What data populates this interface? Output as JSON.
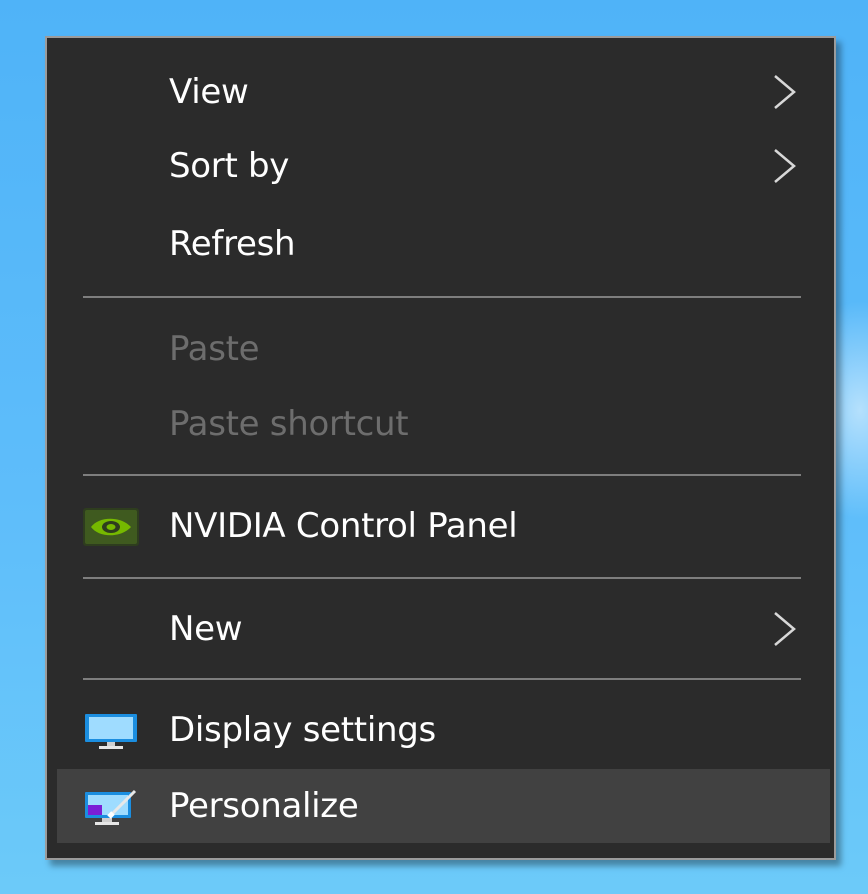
{
  "menu": {
    "items": [
      {
        "label": "View",
        "has_submenu": true,
        "enabled": true
      },
      {
        "label": "Sort by",
        "has_submenu": true,
        "enabled": true
      },
      {
        "label": "Refresh",
        "has_submenu": false,
        "enabled": true
      },
      {
        "label": "Paste",
        "has_submenu": false,
        "enabled": false
      },
      {
        "label": "Paste shortcut",
        "has_submenu": false,
        "enabled": false
      },
      {
        "label": "NVIDIA Control Panel",
        "has_submenu": false,
        "enabled": true,
        "icon": "nvidia-icon"
      },
      {
        "label": "New",
        "has_submenu": true,
        "enabled": true
      },
      {
        "label": "Display settings",
        "has_submenu": false,
        "enabled": true,
        "icon": "display-icon"
      },
      {
        "label": "Personalize",
        "has_submenu": false,
        "enabled": true,
        "icon": "personalize-icon",
        "highlighted": true
      }
    ]
  },
  "colors": {
    "menu_background": "#2b2b2b",
    "menu_border": "#9b9b9b",
    "highlight": "#414141",
    "text": "#ffffff",
    "disabled_text": "#6d6d6d",
    "separator": "#7e7e7e",
    "desktop": "#4fb3f8"
  }
}
